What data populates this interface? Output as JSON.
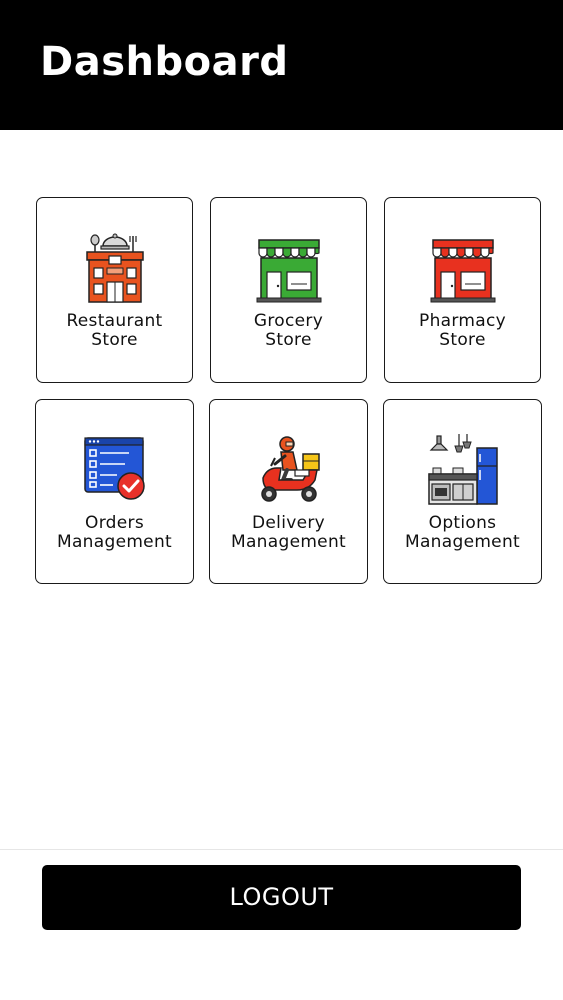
{
  "header": {
    "title": "Dashboard"
  },
  "tiles": [
    {
      "line1": "Restaurant",
      "line2": "Store",
      "icon": "restaurant-store-icon"
    },
    {
      "line1": "Grocery",
      "line2": "Store",
      "icon": "grocery-store-icon"
    },
    {
      "line1": "Pharmacy",
      "line2": "Store",
      "icon": "pharmacy-store-icon"
    },
    {
      "line1": "Orders",
      "line2": "Management",
      "icon": "orders-checklist-icon"
    },
    {
      "line1": "Delivery",
      "line2": "Management",
      "icon": "delivery-scooter-icon"
    },
    {
      "line1": "Options",
      "line2": "Management",
      "icon": "kitchen-appliances-icon"
    }
  ],
  "footer": {
    "logout_label": "LOGOUT"
  },
  "colors": {
    "header_bg": "#000000",
    "restaurant": "#e8531f",
    "grocery": "#3aaa35",
    "pharmacy": "#e8311f",
    "orders": "#2356d6",
    "accent_red": "#e8312a"
  }
}
